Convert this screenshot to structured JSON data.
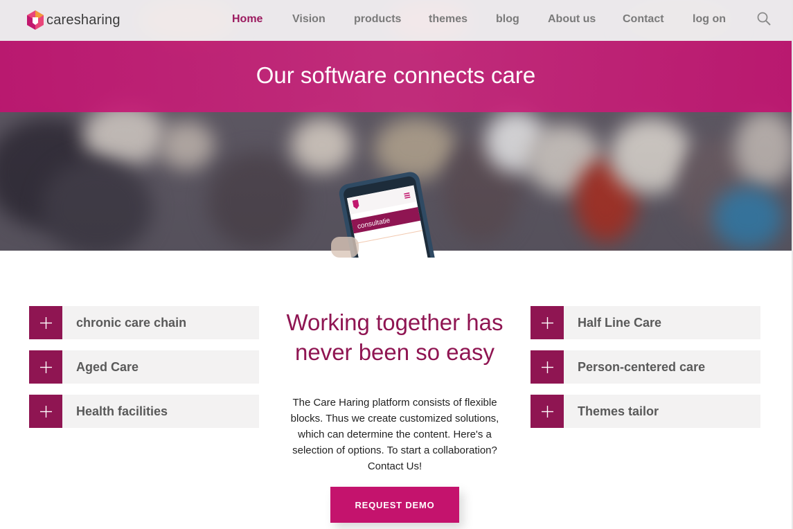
{
  "brand": {
    "name": "caresharing",
    "accent": "#8f1552",
    "banner_color": "#c4136d"
  },
  "nav": {
    "items": [
      {
        "label": "Home",
        "active": true
      },
      {
        "label": "Vision",
        "active": false
      },
      {
        "label": "products",
        "active": false
      },
      {
        "label": "themes",
        "active": false
      },
      {
        "label": "blog",
        "active": false
      },
      {
        "label": "About us",
        "active": false
      },
      {
        "label": "Contact",
        "active": false
      },
      {
        "label": "log on",
        "active": false
      }
    ],
    "search_icon": "search-icon"
  },
  "hero": {
    "title": "Our software connects care",
    "phone_screen_text": "consultatie"
  },
  "left_items": [
    {
      "label": "chronic care chain"
    },
    {
      "label": "Aged Care"
    },
    {
      "label": "Health facilities"
    }
  ],
  "right_items": [
    {
      "label": "Half Line Care"
    },
    {
      "label": "Person-centered care"
    },
    {
      "label": "Themes tailor"
    }
  ],
  "intro": {
    "heading": "Working together has never been so easy",
    "body": "The Care Haring platform consists of flexible blocks. Thus we create customized solutions, which can determine the content. Here's a selection of options. To start a collaboration? Contact Us!",
    "cta": "REQUEST DEMO"
  }
}
